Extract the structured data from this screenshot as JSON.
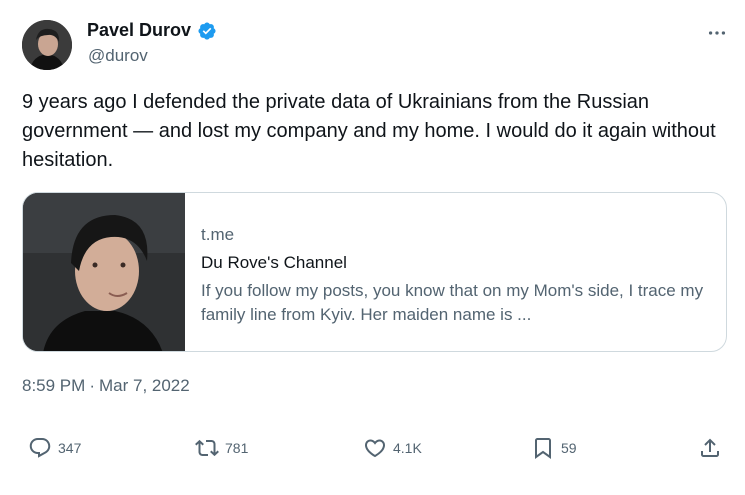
{
  "author": {
    "display_name": "Pavel Durov",
    "handle": "@durov",
    "verified": true,
    "verified_color": "#1d9bf0"
  },
  "tweet": {
    "text": "9 years ago I defended the private data of Ukrainians from the Russian government — and lost my company and my home. I would do it again without hesitation.",
    "time": "8:59 PM",
    "separator": "·",
    "date": "Mar 7, 2022"
  },
  "link_card": {
    "domain": "t.me",
    "title": "Du Rove's Channel",
    "description": "If you follow my posts, you know that on my Mom's side, I trace my family line from Kyiv. Her maiden name is ..."
  },
  "actions": {
    "replies": "347",
    "retweets": "781",
    "likes": "4.1K",
    "bookmarks": "59"
  },
  "icons": {
    "more": "more-dots-icon",
    "reply": "comment-bubble-icon",
    "retweet": "retweet-arrows-icon",
    "like": "heart-icon",
    "bookmark": "bookmark-icon",
    "share": "share-upload-icon"
  },
  "colors": {
    "text_primary": "#0f1419",
    "text_secondary": "#536471",
    "border": "#cfd9de"
  }
}
